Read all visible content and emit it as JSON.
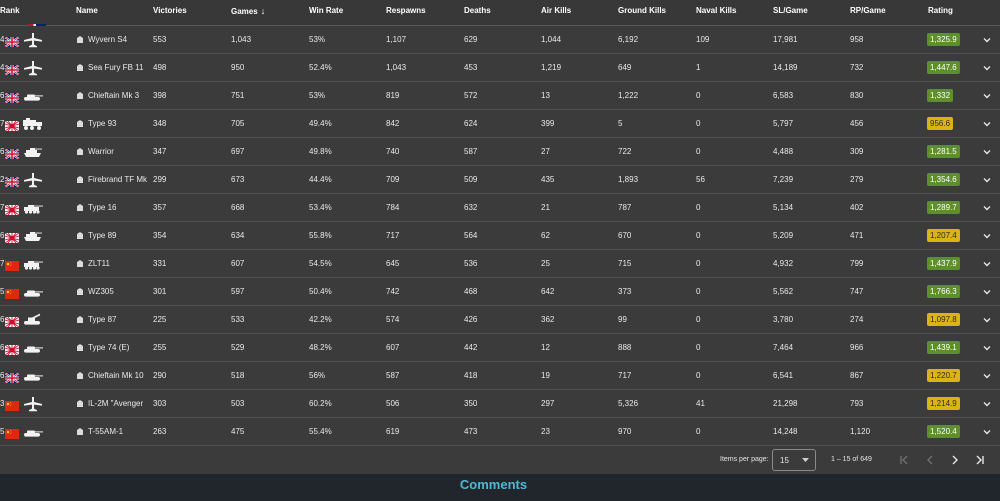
{
  "headers": {
    "rank": "Rank",
    "name": "Name",
    "victories": "Victories",
    "games": "Games",
    "games_sort_icon": "arrow-down",
    "win_rate": "Win Rate",
    "respawns": "Respawns",
    "deaths": "Deaths",
    "air_kills": "Air Kills",
    "ground_kills": "Ground Kills",
    "naval_kills": "Naval Kills",
    "sl_game": "SL/Game",
    "rp_game": "RP/Game",
    "rating": "Rating"
  },
  "rows": [
    {
      "rank": "4",
      "nation": "uk",
      "vehicle_icon": "plane",
      "name": "Wyvern S4",
      "victories": "553",
      "games": "1,043",
      "win_rate": "53%",
      "respawns": "1,107",
      "deaths": "629",
      "air_kills": "1,044",
      "ground_kills": "6,192",
      "naval_kills": "109",
      "sl_game": "17,981",
      "rp_game": "958",
      "rating": "1,325.9",
      "rating_color": "green"
    },
    {
      "rank": "4",
      "nation": "uk",
      "vehicle_icon": "plane",
      "name": "Sea Fury FB 11",
      "victories": "498",
      "games": "950",
      "win_rate": "52.4%",
      "respawns": "1,043",
      "deaths": "453",
      "air_kills": "1,219",
      "ground_kills": "649",
      "naval_kills": "1",
      "sl_game": "14,189",
      "rp_game": "732",
      "rating": "1,447.6",
      "rating_color": "green"
    },
    {
      "rank": "6",
      "nation": "uk",
      "vehicle_icon": "tank",
      "name": "Chieftain Mk 3",
      "victories": "398",
      "games": "751",
      "win_rate": "53%",
      "respawns": "819",
      "deaths": "572",
      "air_kills": "13",
      "ground_kills": "1,222",
      "naval_kills": "0",
      "sl_game": "6,583",
      "rp_game": "830",
      "rating": "1,332",
      "rating_color": "green"
    },
    {
      "rank": "7",
      "nation": "japan",
      "vehicle_icon": "truck",
      "name": "Type 93",
      "victories": "348",
      "games": "705",
      "win_rate": "49.4%",
      "respawns": "842",
      "deaths": "624",
      "air_kills": "399",
      "ground_kills": "5",
      "naval_kills": "0",
      "sl_game": "5,797",
      "rp_game": "456",
      "rating": "956.6",
      "rating_color": "yellow"
    },
    {
      "rank": "6",
      "nation": "uk",
      "vehicle_icon": "ifv",
      "name": "Warrior",
      "victories": "347",
      "games": "697",
      "win_rate": "49.8%",
      "respawns": "740",
      "deaths": "587",
      "air_kills": "27",
      "ground_kills": "722",
      "naval_kills": "0",
      "sl_game": "4,488",
      "rp_game": "309",
      "rating": "1,281.5",
      "rating_color": "green"
    },
    {
      "rank": "2",
      "nation": "uk",
      "vehicle_icon": "plane",
      "name": "Firebrand TF Mk",
      "victories": "299",
      "games": "673",
      "win_rate": "44.4%",
      "respawns": "709",
      "deaths": "509",
      "air_kills": "435",
      "ground_kills": "1,893",
      "naval_kills": "56",
      "sl_game": "7,239",
      "rp_game": "279",
      "rating": "1,354.6",
      "rating_color": "green"
    },
    {
      "rank": "7",
      "nation": "japan",
      "vehicle_icon": "wheeled",
      "name": "Type 16",
      "victories": "357",
      "games": "668",
      "win_rate": "53.4%",
      "respawns": "784",
      "deaths": "632",
      "air_kills": "21",
      "ground_kills": "787",
      "naval_kills": "0",
      "sl_game": "5,134",
      "rp_game": "402",
      "rating": "1,289.7",
      "rating_color": "green"
    },
    {
      "rank": "6",
      "nation": "japan",
      "vehicle_icon": "ifv",
      "name": "Type 89",
      "victories": "354",
      "games": "634",
      "win_rate": "55.8%",
      "respawns": "717",
      "deaths": "564",
      "air_kills": "62",
      "ground_kills": "670",
      "naval_kills": "0",
      "sl_game": "5,209",
      "rp_game": "471",
      "rating": "1,207.4",
      "rating_color": "yellow"
    },
    {
      "rank": "7",
      "nation": "china",
      "vehicle_icon": "wheeled",
      "name": "ZLT11",
      "victories": "331",
      "games": "607",
      "win_rate": "54.5%",
      "respawns": "645",
      "deaths": "536",
      "air_kills": "25",
      "ground_kills": "715",
      "naval_kills": "0",
      "sl_game": "4,932",
      "rp_game": "799",
      "rating": "1,437.9",
      "rating_color": "green"
    },
    {
      "rank": "5",
      "nation": "china",
      "vehicle_icon": "tank",
      "name": "WZ305",
      "victories": "301",
      "games": "597",
      "win_rate": "50.4%",
      "respawns": "742",
      "deaths": "468",
      "air_kills": "642",
      "ground_kills": "373",
      "naval_kills": "0",
      "sl_game": "5,562",
      "rp_game": "747",
      "rating": "1,766.3",
      "rating_color": "green"
    },
    {
      "rank": "6",
      "nation": "japan",
      "vehicle_icon": "spaa",
      "name": "Type 87",
      "victories": "225",
      "games": "533",
      "win_rate": "42.2%",
      "respawns": "574",
      "deaths": "426",
      "air_kills": "362",
      "ground_kills": "99",
      "naval_kills": "0",
      "sl_game": "3,780",
      "rp_game": "274",
      "rating": "1,097.8",
      "rating_color": "yellow"
    },
    {
      "rank": "6",
      "nation": "japan",
      "vehicle_icon": "tank",
      "name": "Type 74 (E)",
      "victories": "255",
      "games": "529",
      "win_rate": "48.2%",
      "respawns": "607",
      "deaths": "442",
      "air_kills": "12",
      "ground_kills": "888",
      "naval_kills": "0",
      "sl_game": "7,464",
      "rp_game": "966",
      "rating": "1,439.1",
      "rating_color": "green"
    },
    {
      "rank": "6",
      "nation": "uk",
      "vehicle_icon": "tank",
      "name": "Chieftain Mk 10",
      "victories": "290",
      "games": "518",
      "win_rate": "56%",
      "respawns": "587",
      "deaths": "418",
      "air_kills": "19",
      "ground_kills": "717",
      "naval_kills": "0",
      "sl_game": "6,541",
      "rp_game": "867",
      "rating": "1,220.7",
      "rating_color": "yellow"
    },
    {
      "rank": "3",
      "nation": "china",
      "vehicle_icon": "plane",
      "name": "IL-2M \"Avenger",
      "victories": "303",
      "games": "503",
      "win_rate": "60.2%",
      "respawns": "506",
      "deaths": "350",
      "air_kills": "297",
      "ground_kills": "5,326",
      "naval_kills": "41",
      "sl_game": "21,298",
      "rp_game": "793",
      "rating": "1,214.9",
      "rating_color": "yellow"
    },
    {
      "rank": "5",
      "nation": "china",
      "vehicle_icon": "tank",
      "name": "T-55AM-1",
      "victories": "263",
      "games": "475",
      "win_rate": "55.4%",
      "respawns": "619",
      "deaths": "473",
      "air_kills": "23",
      "ground_kills": "970",
      "naval_kills": "0",
      "sl_game": "14,248",
      "rp_game": "1,120",
      "rating": "1,520.4",
      "rating_color": "green"
    }
  ],
  "paginator": {
    "items_per_page_label": "Items per page:",
    "items_per_page_value": "15",
    "range_label": "1 – 15 of 649"
  },
  "comments": {
    "title": "Comments"
  },
  "colors": {
    "rating_green": "#5e8f2a",
    "rating_yellow": "#d9b413",
    "comments_title": "#4fb8d4"
  }
}
